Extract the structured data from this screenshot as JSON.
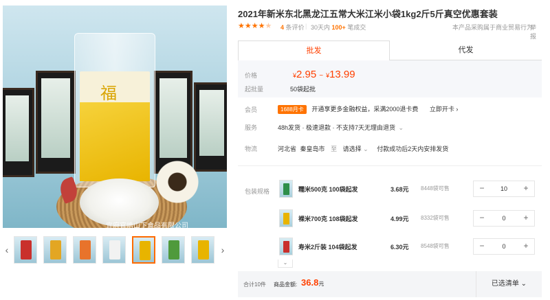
{
  "gallery": {
    "watermark": "宜府官皓山下食品有限公司",
    "main_bag_stamp": "福",
    "thumbs": [
      {
        "color": "#c9302c"
      },
      {
        "color": "#e3a623"
      },
      {
        "color": "#e8732b"
      },
      {
        "color": "#f2f2f2"
      },
      {
        "color": "#e8b400"
      },
      {
        "color": "#4f9a3c"
      },
      {
        "color": "#e8b400"
      }
    ],
    "active_thumb_index": 4,
    "prev_arrow": "‹",
    "next_arrow": "›"
  },
  "product": {
    "title": "2021年新米东北黑龙江五常大米江米小袋1kg2斤5斤真空优惠套装",
    "rating": "4",
    "review_count_label": "条评价",
    "sold_prefix": "30天内",
    "sold_count": "100+",
    "sold_suffix": "笔成交",
    "insurance_note": "本产品采购属于商业贸易行为",
    "report_label": "举报"
  },
  "tabs": {
    "wholesale": "批发",
    "dropship": "代发"
  },
  "price": {
    "label": "价格",
    "currency": "¥",
    "min": "2.95",
    "max": "13.99",
    "tilde": "~",
    "moq_label": "起批量",
    "moq_value": "50袋起批"
  },
  "member": {
    "label": "会员",
    "card_tag": "1688月卡",
    "text": "开通享更多金融权益，采满2000退卡费",
    "action": "立即开卡 ›"
  },
  "service": {
    "label": "服务",
    "text": "48h发货 · 极速退款 · 不支持7天无理由退货",
    "chevron": "⌄"
  },
  "logistics": {
    "label": "物流",
    "province": "河北省",
    "city": "秦皇岛市",
    "to": "至",
    "select_placeholder": "请选择",
    "chevron": "⌄",
    "note": "付款成功后2天内安排发货"
  },
  "sku": {
    "label": "包装规格",
    "items": [
      {
        "name": "糯米500克 100袋起发",
        "price": "3.68元",
        "stock": "8448袋可售",
        "qty": "10",
        "color": "#2e8f4a"
      },
      {
        "name": "裸米700克 108袋起发",
        "price": "4.99元",
        "stock": "8332袋可售",
        "qty": "0",
        "color": "#e8b400"
      },
      {
        "name": "寿米2斤装 104袋起发",
        "price": "6.30元",
        "stock": "8548袋可售",
        "qty": "0",
        "color": "#c9302c"
      }
    ],
    "minus": "−",
    "plus": "+",
    "more_chevron": "⌄"
  },
  "footer": {
    "count": "合计10件",
    "amount_label": "商品金额:",
    "amount": "36.8",
    "amount_unit": "元",
    "selected_label": "已选清单 ⌄"
  },
  "colors": {
    "accent": "#ff4000",
    "orange": "#ff7300"
  }
}
